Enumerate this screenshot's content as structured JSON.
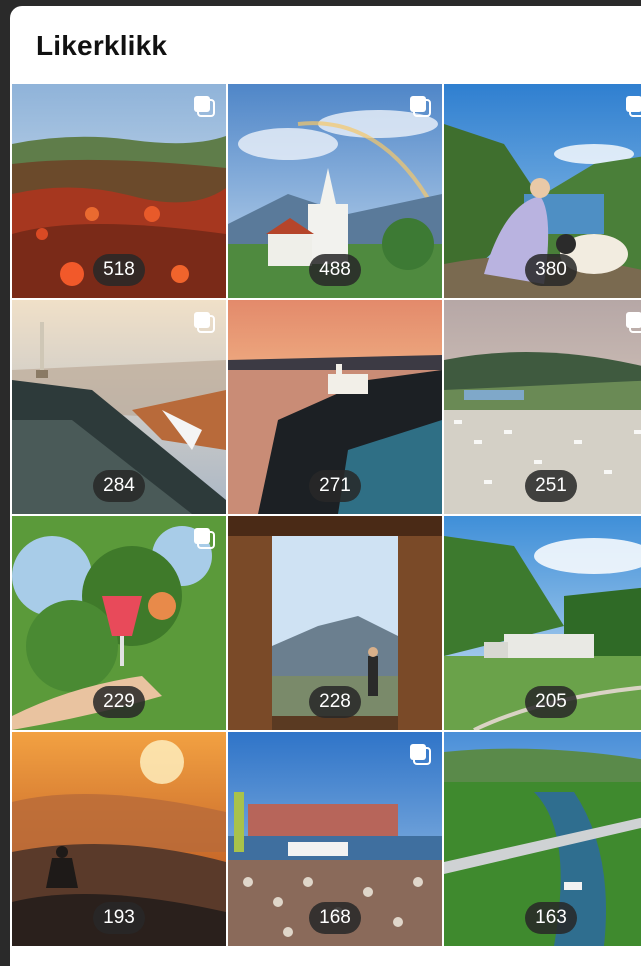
{
  "header": {
    "title": "Likerklikk"
  },
  "icons": {
    "multi": "stacked-squares-icon"
  },
  "grid": {
    "tiles": [
      {
        "count": "518",
        "subject": "cloudberries",
        "multi": true
      },
      {
        "count": "488",
        "subject": "church-rainbow",
        "multi": true
      },
      {
        "count": "380",
        "subject": "woman-sheep-fjord",
        "multi": true
      },
      {
        "count": "284",
        "subject": "mountain-tower",
        "multi": true
      },
      {
        "count": "271",
        "subject": "lighthouse-sunset",
        "multi": false
      },
      {
        "count": "251",
        "subject": "campsite-valley",
        "multi": true
      },
      {
        "count": "229",
        "subject": "apple-drink",
        "multi": true
      },
      {
        "count": "228",
        "subject": "wooden-gate-view",
        "multi": false
      },
      {
        "count": "205",
        "subject": "power-station",
        "multi": false
      },
      {
        "count": "193",
        "subject": "sunset-hiker",
        "multi": false
      },
      {
        "count": "168",
        "subject": "harbour-festival",
        "multi": true
      },
      {
        "count": "163",
        "subject": "river-bridge",
        "multi": false
      }
    ]
  }
}
